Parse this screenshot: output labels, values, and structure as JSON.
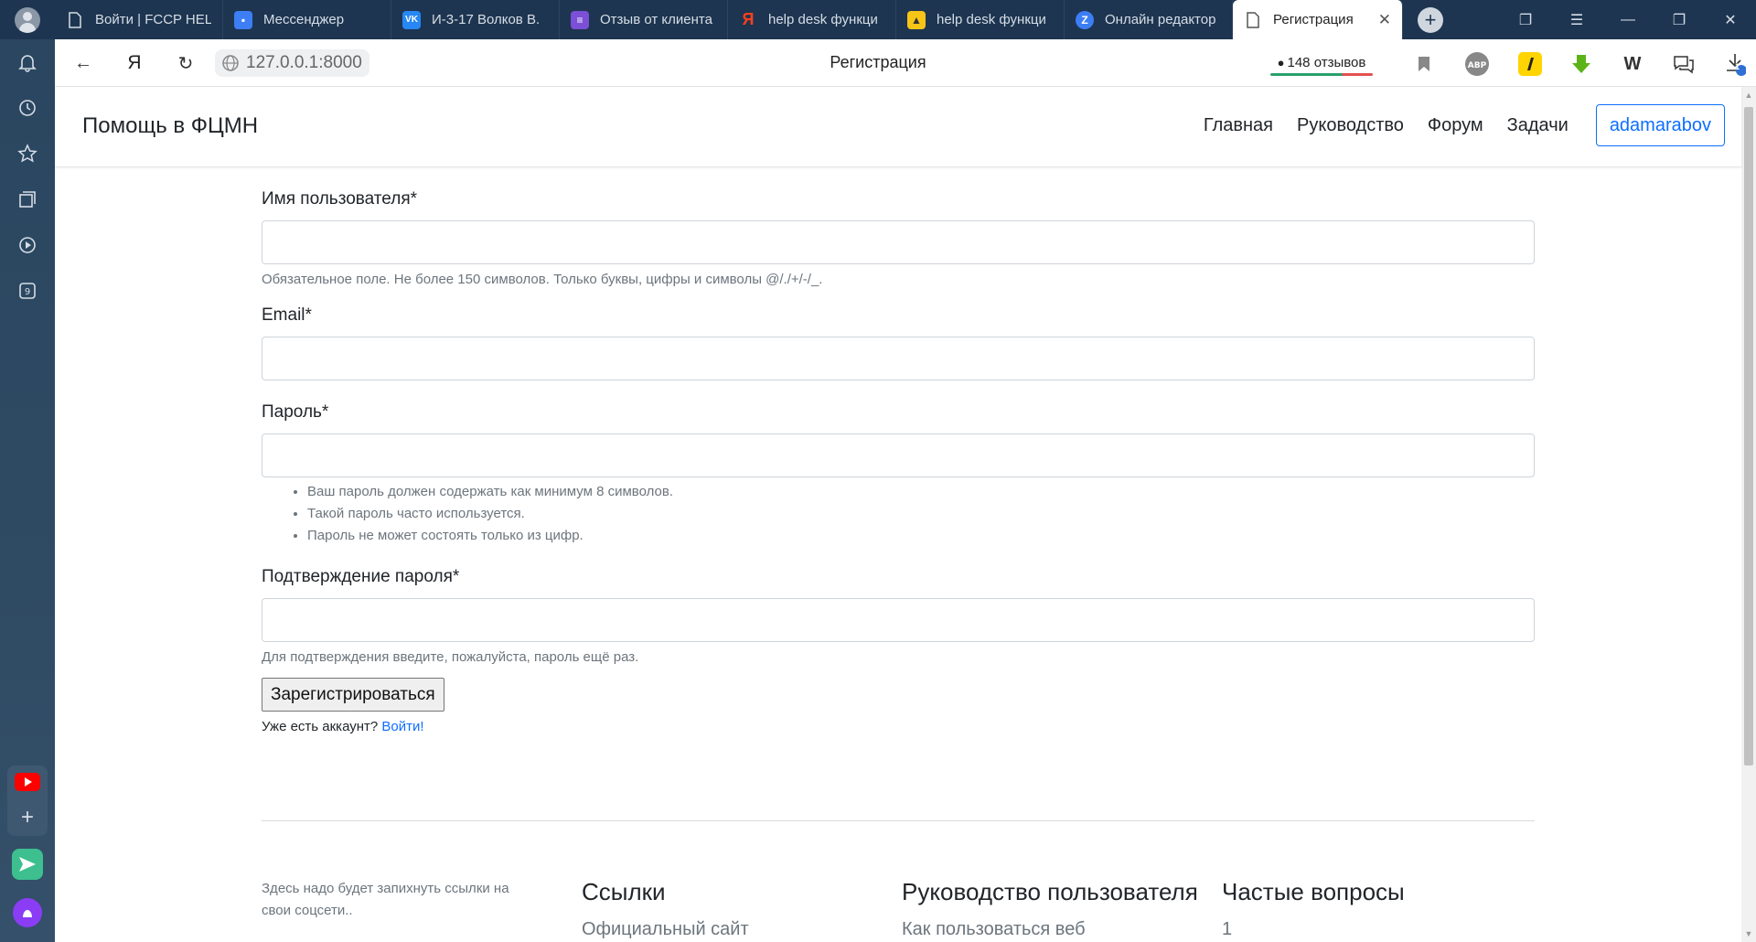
{
  "browser": {
    "tabs": [
      {
        "label": "Войти | FCCP HEL",
        "icon": "doc-icon",
        "color": "#d6dde6"
      },
      {
        "label": "Мессенджер",
        "icon": "messenger-icon",
        "color": "#3d7ef5"
      },
      {
        "label": "И-3-17 Волков В.",
        "icon": "vk-icon",
        "color": "#2787f5"
      },
      {
        "label": "Отзыв от клиента",
        "icon": "form-icon",
        "color": "#7b4fd6"
      },
      {
        "label": "help desk функци",
        "icon": "yandex-icon",
        "color": "#fc3f1d"
      },
      {
        "label": "help desk функци",
        "icon": "image-icon",
        "color": "#f5c518"
      },
      {
        "label": "Онлайн редактор",
        "icon": "editor-icon",
        "color": "#3d7ef5"
      },
      {
        "label": "Регистрация",
        "icon": "doc-icon",
        "color": "#555555"
      }
    ],
    "url": "127.0.0.1:8000",
    "page_title": "Регистрация",
    "reviews": "148 отзывов",
    "downloads_badge": "1"
  },
  "site": {
    "brand": "Помощь в ФЦМН",
    "nav": [
      "Главная",
      "Руководство",
      "Форум",
      "Задачи"
    ],
    "user": "adamarabov"
  },
  "form": {
    "username_label": "Имя пользователя*",
    "username_help": "Обязательное поле. Не более 150 символов. Только буквы, цифры и символы @/./+/-/_.",
    "email_label": "Email*",
    "password_label": "Пароль*",
    "password_help": [
      "Ваш пароль должен содержать как минимум 8 символов.",
      "Такой пароль часто используется.",
      "Пароль не может состоять только из цифр."
    ],
    "confirm_label": "Подтверждение пароля*",
    "confirm_help": "Для подтверждения введите, пожалуйста, пароль ещё раз.",
    "submit": "Зарегистрироваться",
    "already_text": "Уже есть аккаунт? ",
    "login_link": "Войти!"
  },
  "footer": {
    "note": "Здесь надо будет запихнуть ссылки на свои соцсети..",
    "links_title": "Ссылки",
    "links_first": "Официальный сайт",
    "guide_title": "Руководство пользователя",
    "guide_first": "Как пользоваться веб",
    "faq_title": "Частые вопросы",
    "faq_first": "1"
  }
}
